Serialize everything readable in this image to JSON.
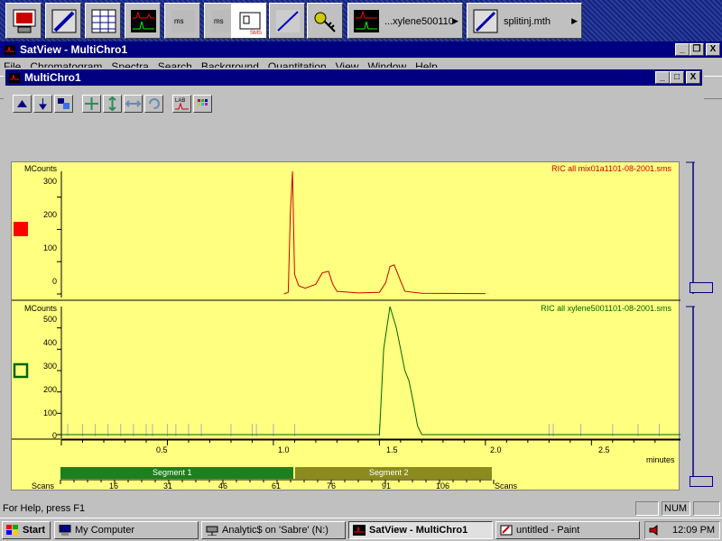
{
  "launchbar": {
    "item1_label": "...xylene500110",
    "item2_label": "splitinj.mth"
  },
  "window": {
    "title": "SatView - MultiChro1",
    "min": "_",
    "max": "❐",
    "close": "X"
  },
  "menu": [
    "File",
    "Chromatogram",
    "Spectra",
    "Search",
    "Background",
    "Quantitation",
    "View",
    "Window",
    "Help"
  ],
  "child": {
    "title": "MultiChro1",
    "min": "_",
    "max": "□",
    "close": "X"
  },
  "plots": {
    "top": {
      "ylabel": "MCounts",
      "legend": "RIC all mix01a1101-08-2001.sms",
      "color": "#cc0000",
      "yticks": [
        "300",
        "200",
        "100",
        "0"
      ]
    },
    "bottom": {
      "ylabel": "MCounts",
      "legend": "RIC all xylene5001101-08-2001.sms",
      "color": "#006600",
      "yticks": [
        "500",
        "400",
        "300",
        "200",
        "100",
        "0"
      ]
    },
    "xticks": [
      "0.5",
      "1.0",
      "1.5",
      "2.0",
      "2.5"
    ],
    "xunit": "minutes",
    "segments": [
      "Segment 1",
      "Segment 2"
    ],
    "scans_label": "Scans",
    "scan_ticks": [
      "16",
      "31",
      "46",
      "61",
      "76",
      "91",
      "106"
    ],
    "scans_label_right": "Scans"
  },
  "chart_data": [
    {
      "type": "line",
      "legend": "RIC all mix01a1101-08-2001.sms",
      "ylabel": "MCounts",
      "xlabel": "minutes",
      "xlim": [
        0,
        3.0
      ],
      "ylim": [
        0,
        380
      ],
      "x": [
        1.05,
        1.07,
        1.08,
        1.09,
        1.1,
        1.12,
        1.15,
        1.2,
        1.23,
        1.26,
        1.28,
        1.3,
        1.4,
        1.5,
        1.53,
        1.55,
        1.57,
        1.6,
        1.62,
        1.7,
        2.0
      ],
      "y": [
        0,
        5,
        250,
        380,
        60,
        25,
        18,
        30,
        65,
        70,
        30,
        8,
        3,
        5,
        35,
        85,
        90,
        40,
        8,
        2,
        1
      ]
    },
    {
      "type": "line",
      "legend": "RIC all xylene5001101-08-2001.sms",
      "ylabel": "MCounts",
      "xlabel": "minutes",
      "xlim": [
        0,
        3.0
      ],
      "ylim": [
        0,
        600
      ],
      "x": [
        0,
        1.5,
        1.52,
        1.55,
        1.58,
        1.6,
        1.62,
        1.64,
        1.66,
        1.68,
        1.7,
        3.0
      ],
      "y": [
        0,
        0,
        400,
        600,
        500,
        400,
        300,
        250,
        150,
        40,
        0,
        0
      ]
    }
  ],
  "status": {
    "help": "For Help, press F1",
    "num": "NUM"
  },
  "taskbar": {
    "start": "Start",
    "tasks": [
      "My Computer",
      "Analytic$ on 'Sabre' (N:)",
      "SatView - MultiChro1",
      "untitled - Paint"
    ],
    "clock": "12:09 PM"
  }
}
